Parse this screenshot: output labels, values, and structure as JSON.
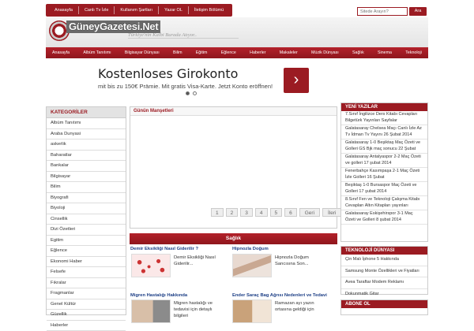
{
  "topnav": [
    "Anasayfa",
    "Canlı Tv İzle",
    "Kullanım Şartları",
    "Yazar OL",
    "İletişim Bölümü"
  ],
  "search": {
    "placeholder": "Sitede Arayın?",
    "button": "Ara"
  },
  "header": {
    "logo": "GüneyGazetesi.Net",
    "tagline": "Türkiye'nin Kalbi Burada Atıyor.."
  },
  "mainnav": [
    "Anasayfa",
    "Albüm Tanıtımı",
    "Bilgisayar Dünyası",
    "Bilim",
    "Eğitim",
    "Eğlence",
    "Haberler",
    "Makaleler",
    "Müzik Dünyası",
    "Sağlık",
    "Sinema",
    "Teknoloji"
  ],
  "ad": {
    "title": "Kostenloses Girokonto",
    "subtitle": "mit bis zu 150€ Prämie. Mit gratis Visa-Karte. Jetzt Konto eröffnen!",
    "arrow": "›"
  },
  "categories": {
    "title": "KATEGORİLER",
    "items": [
      "Albüm Tanıtımı",
      "Araba Dunyasi",
      "askerlik",
      "Baharatlar",
      "Bankalar",
      "Bilgisayar",
      "Bilim",
      "Biyografi",
      "Biyoloji",
      "Cinsellik",
      "Dizi Özetleri",
      "Egitim",
      "Eğlence",
      "Ekonomi Haber",
      "Felsefe",
      "Fıkralar",
      "Fragmanlar",
      "Genel Kültür",
      "Güzellik",
      "Haberler"
    ]
  },
  "manset": {
    "title": "Günün Manşetleri",
    "pages": [
      "1",
      "2",
      "3",
      "4",
      "5",
      "6",
      "Geri",
      "İleri"
    ]
  },
  "saglik": {
    "title": "Sağlık",
    "news": [
      {
        "title": "Demir Eksikliği Nasıl Giderilir ?",
        "text": "Demir Eksikliği Nasıl Giderilir..."
      },
      {
        "title": "Hipnozla Doğum",
        "text": "Hipnozla Doğum Sancısına Son..."
      },
      {
        "title": "Migren Hastalığı Hakkında",
        "text": "Migren hastalığı ve tedavisi için detaylı bilgileri"
      },
      {
        "title": "Ender Saraç Bag Ağrısı Nedenleri ve Tedavi",
        "text": "Ramazan ayı yazın ortasına geldiği için"
      }
    ]
  },
  "yeni_yazilar": {
    "title": "YENİ YAZILAR",
    "items": [
      "7.Sınıf İngilizce Ders Kitabı Cevapları Bilgetürk Yayınları Sayfalar",
      "Galatasaray Chelsea Maçı Canlı İzle Az Tv İdman Tv Yayını 26 Şubat 2014",
      "Galatasaray 1-0 Beşiktaş Maç Özeti ve Golleri GS Bjk maç sonucu 22 Şubat",
      "Galatasaray Antalyaspor 2-2 Maç Özeti ve golleri 17 şubat 2014",
      "Fenerbahçe Kasımpaşa 2-1 Maç Özeti İzle Golleri 16 Şubat",
      "Beşiktaş 1-0 Bursaspor Maç Özeti ve Golleri 17 şubat 2014",
      "8.Sınıf Fen ve Teknoloji Çalışma Kitabı Cevapları Altın Kitapları yayınları",
      "Galatasaray Eskişehirspor 3-1 Maç Özeti ve Golleri 8 şubat 2014"
    ]
  },
  "teknoloji": {
    "title": "TEKNOLOJİ DÜNYASI",
    "items": [
      "Çin Malı İphone 5 Hakkında",
      "Samsung Monte Özellikleri ve Fiyatları",
      "Avea Taraftar Modem Reklamı",
      "Dokunmatik Gitar"
    ]
  },
  "abone": {
    "title": "ABONE OL"
  },
  "colors": {
    "brand": "#9b1b22",
    "link": "#1d3f86"
  }
}
